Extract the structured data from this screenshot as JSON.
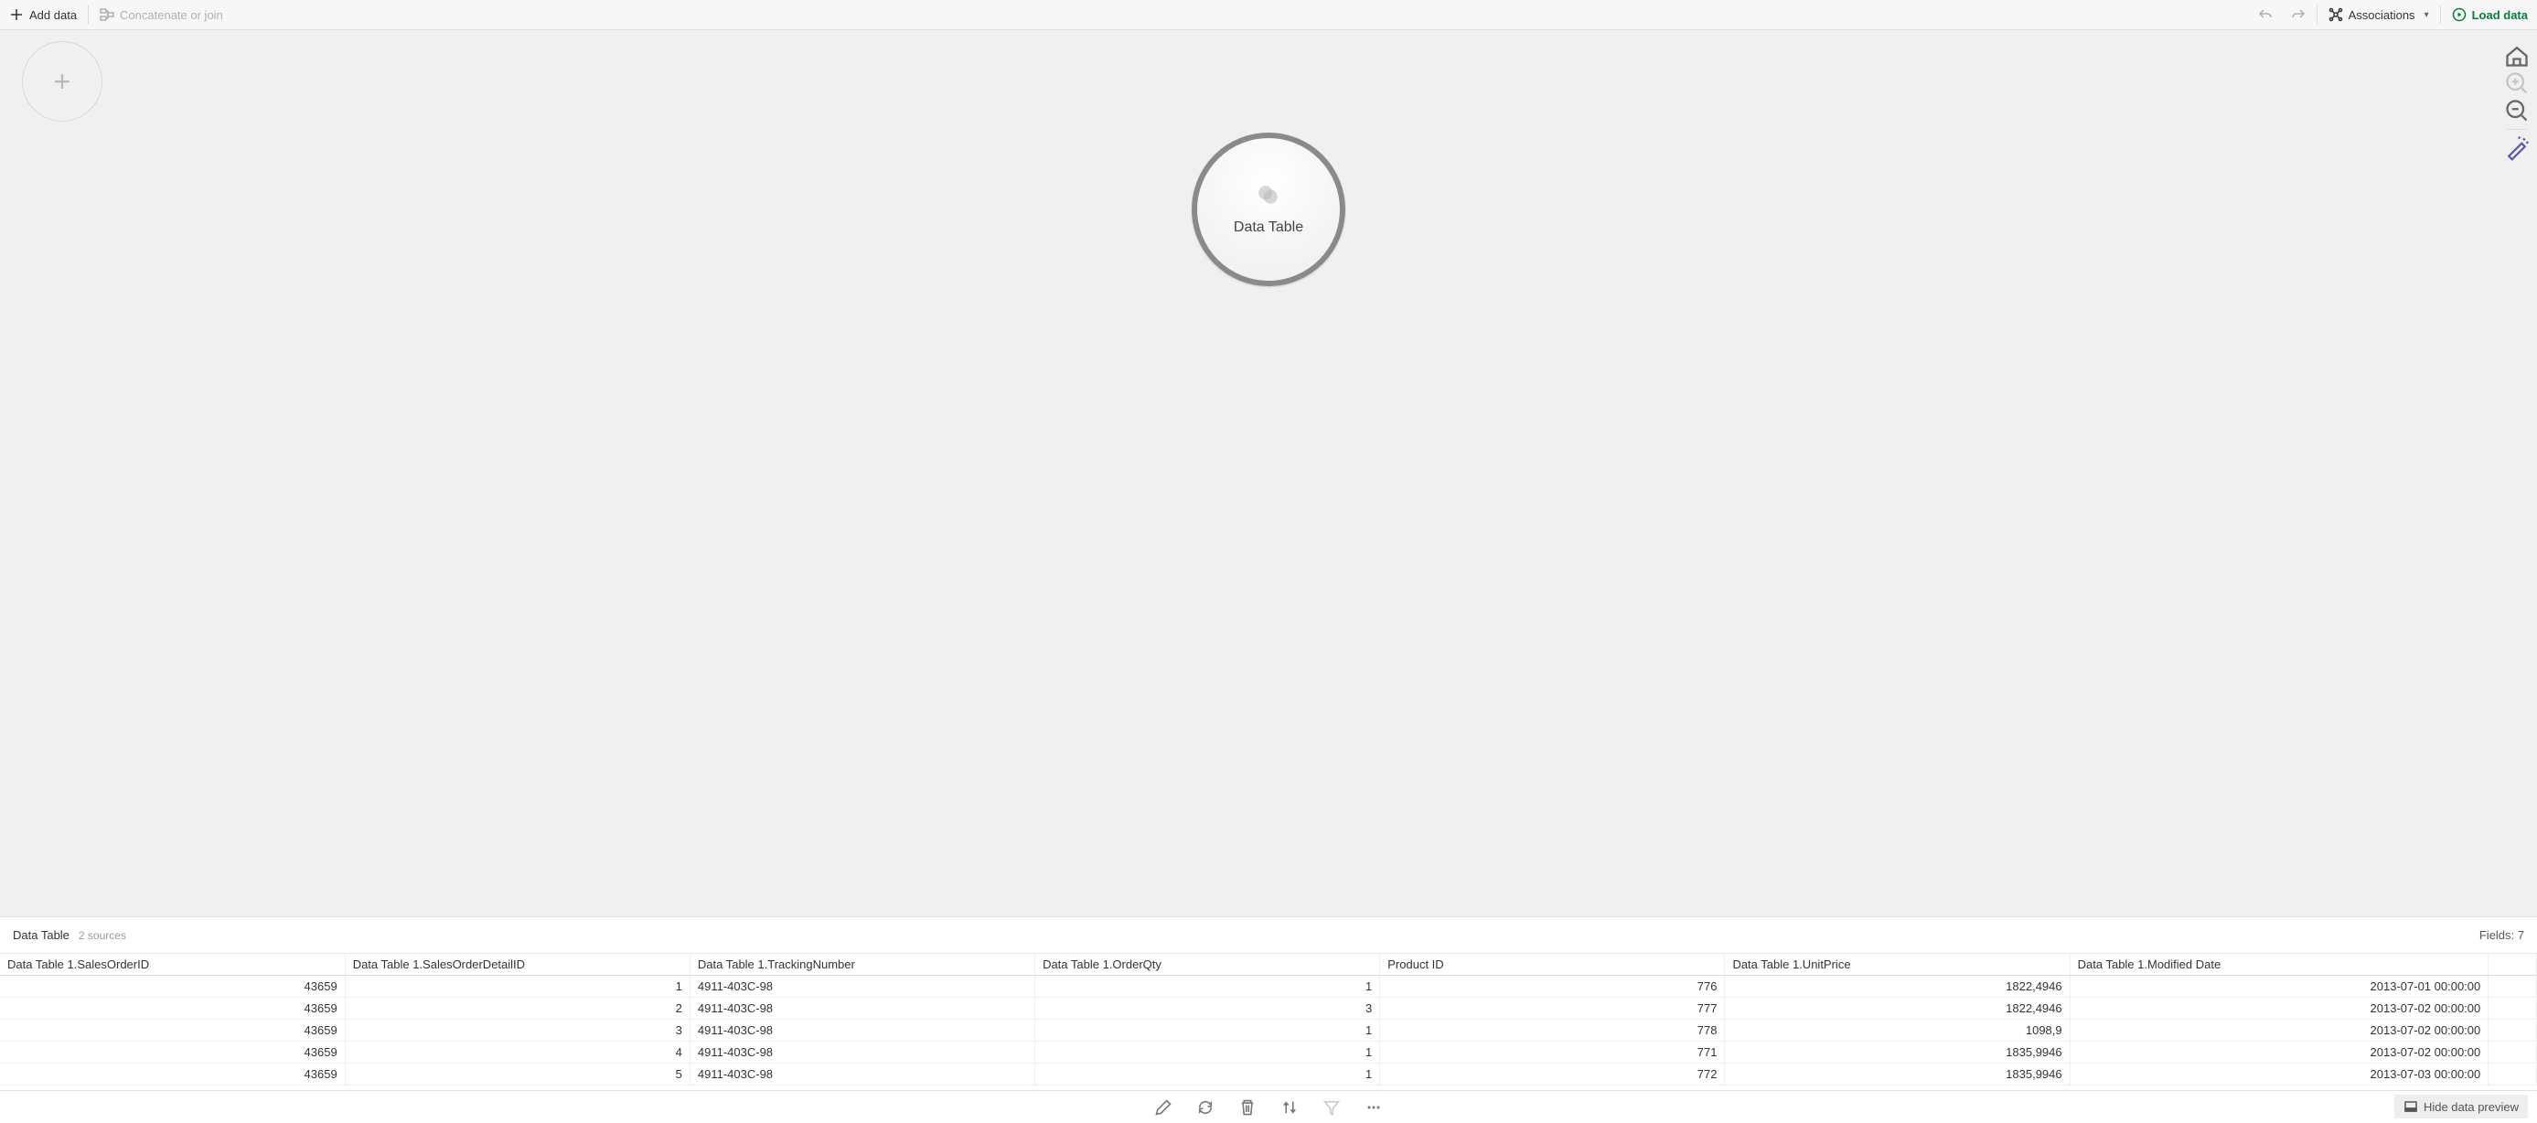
{
  "toolbar": {
    "add_data": "Add data",
    "concat_join": "Concatenate or join",
    "associations": "Associations",
    "load_data": "Load data"
  },
  "bubble": {
    "label": "Data Table"
  },
  "preview": {
    "table_name": "Data Table",
    "sources": "2 sources",
    "fields_label": "Fields: 7"
  },
  "bottom": {
    "hide_preview": "Hide data preview"
  },
  "columns": [
    "Data Table 1.SalesOrderID",
    "Data Table 1.SalesOrderDetailID",
    "Data Table 1.TrackingNumber",
    "Data Table 1.OrderQty",
    "Product ID",
    "Data Table 1.UnitPrice",
    "Data Table 1.Modified Date"
  ],
  "col_align": [
    "num",
    "num",
    "txt",
    "num",
    "num",
    "num",
    "num"
  ],
  "rows": [
    [
      "43659",
      "1",
      "4911-403C-98",
      "1",
      "776",
      "1822,4946",
      "2013-07-01 00:00:00"
    ],
    [
      "43659",
      "2",
      "4911-403C-98",
      "3",
      "777",
      "1822,4946",
      "2013-07-02 00:00:00"
    ],
    [
      "43659",
      "3",
      "4911-403C-98",
      "1",
      "778",
      "1098,9",
      "2013-07-02 00:00:00"
    ],
    [
      "43659",
      "4",
      "4911-403C-98",
      "1",
      "771",
      "1835,9946",
      "2013-07-02 00:00:00"
    ],
    [
      "43659",
      "5",
      "4911-403C-98",
      "1",
      "772",
      "1835,9946",
      "2013-07-03 00:00:00"
    ]
  ]
}
